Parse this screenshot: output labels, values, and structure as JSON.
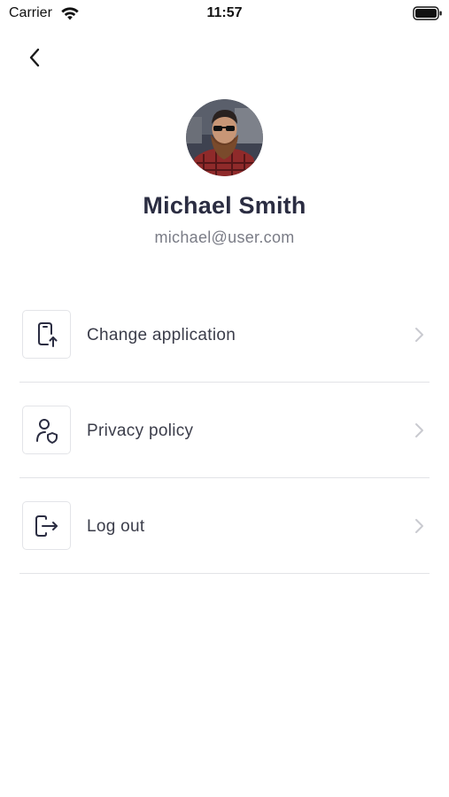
{
  "status_bar": {
    "carrier": "Carrier",
    "time": "11:57"
  },
  "header": {
    "back_icon": "chevron-left-icon"
  },
  "profile": {
    "name": "Michael Smith",
    "email": "michael@user.com"
  },
  "menu": {
    "items": [
      {
        "label": "Change application",
        "icon": "phone-upload-icon"
      },
      {
        "label": "Privacy policy",
        "icon": "user-shield-icon"
      },
      {
        "label": "Log out",
        "icon": "logout-icon"
      }
    ]
  },
  "colors": {
    "text_primary": "#2b2d42",
    "text_secondary": "#7a7c86",
    "divider": "#e2e3e7",
    "chevron": "#c9cad0"
  }
}
